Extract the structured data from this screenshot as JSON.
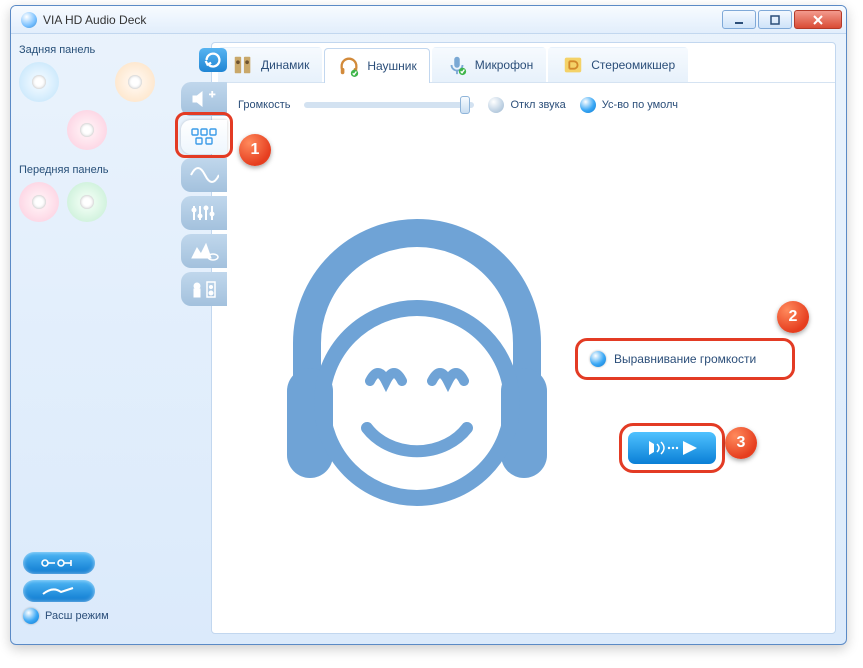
{
  "window": {
    "title": "VIA HD Audio Deck"
  },
  "left": {
    "rear_label": "Задняя панель",
    "front_label": "Передняя панель",
    "mode_label": "Расш режим"
  },
  "sidetabs": {
    "reset": "reset-icon",
    "items": [
      "volume-icon",
      "speakers-icon",
      "wave-icon",
      "equalizer-icon",
      "environment-icon",
      "room-icon"
    ]
  },
  "toptabs": {
    "speaker": "Динамик",
    "headphone": "Наушник",
    "mic": "Микрофон",
    "mixer": "Стереомикшер"
  },
  "volume": {
    "label": "Громкость",
    "mute": "Откл звука",
    "default": "Ус-во по умолч"
  },
  "leveling": {
    "label": "Выравнивание громкости"
  },
  "callouts": {
    "one": "1",
    "two": "2",
    "three": "3"
  }
}
